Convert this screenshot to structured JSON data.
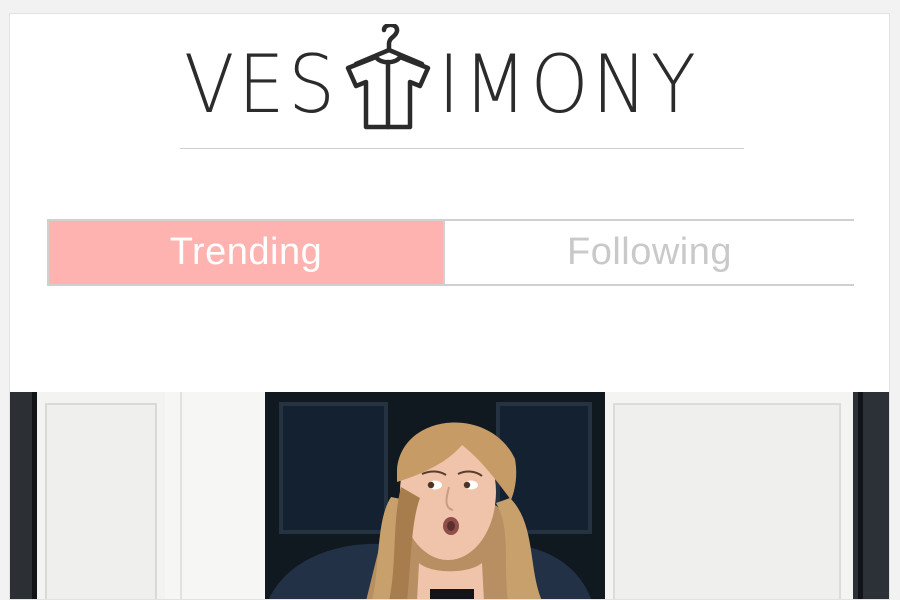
{
  "brand": {
    "logo_prefix": "VES",
    "logo_suffix": "IMONY",
    "logo_icon": "tshirt-hanger-icon"
  },
  "tabs": [
    {
      "label": "Trending",
      "active": true
    },
    {
      "label": "Following",
      "active": false
    }
  ],
  "colors": {
    "active_tab_bg": "#ffb3b0",
    "active_tab_text": "#ffffff",
    "inactive_tab_text": "#c9c9c9",
    "tab_border": "#d0d0d0",
    "logo_ink": "#2b2b2b"
  },
  "feed": {
    "first_post_image": "woman-in-doorway-photo"
  }
}
